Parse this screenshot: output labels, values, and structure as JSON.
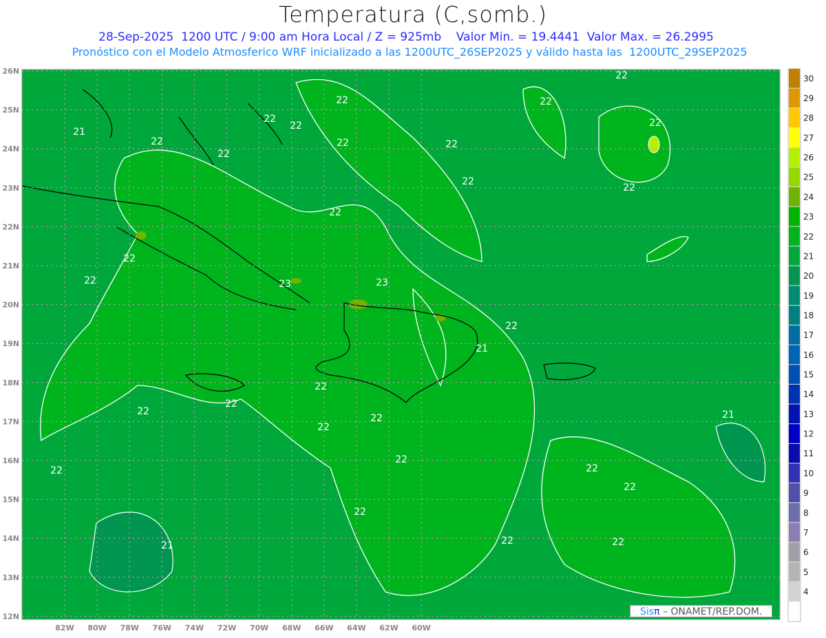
{
  "header": {
    "title": "Temperatura (C,somb.)",
    "line1": "28-Sep-2025  1200 UTC / 9:00 am Hora Local / Z = 925mb    Valor Min. = 19.4441  Valor Max. = 26.2995",
    "line2": "Pronóstico con el Modelo Atmosferico WRF inicializado a las 1200UTC_26SEP2025 y válido hasta las  1200UTC_29SEP2025"
  },
  "map": {
    "lon_labels": [
      "82W",
      "80W",
      "78W",
      "76W",
      "74W",
      "72W",
      "70W",
      "68W",
      "66W",
      "64W",
      "62W",
      "60W"
    ],
    "lat_labels": [
      "26N",
      "25N",
      "24N",
      "23N",
      "22N",
      "21N",
      "20N",
      "19N",
      "18N",
      "17N",
      "16N",
      "15N",
      "14N",
      "13N",
      "12N"
    ],
    "contour_labels": [
      "22",
      "22",
      "22",
      "22",
      "22",
      "22",
      "22",
      "22",
      "22",
      "22",
      "22",
      "22",
      "22",
      "21",
      "21",
      "21",
      "22",
      "22",
      "22",
      "22",
      "22",
      "22",
      "22",
      "23",
      "23",
      "22",
      "22",
      "22",
      "22",
      "22",
      "22",
      "22",
      "21",
      "22"
    ]
  },
  "colorbar": {
    "labels": [
      "30",
      "29",
      "28",
      "27",
      "26",
      "25",
      "24",
      "23",
      "22",
      "21",
      "20",
      "19",
      "18",
      "17",
      "16",
      "15",
      "14",
      "13",
      "12",
      "11",
      "10",
      "9",
      "8",
      "7",
      "6",
      "5",
      "4"
    ],
    "colors": [
      "#c08000",
      "#e09800",
      "#ffc800",
      "#ffff00",
      "#b4f000",
      "#96d800",
      "#6eb400",
      "#00b400",
      "#00b41e",
      "#00a83c",
      "#009650",
      "#008c6e",
      "#008080",
      "#006ea0",
      "#0064b4",
      "#0050b4",
      "#0032b4",
      "#0014b4",
      "#0000c8",
      "#0a0aaf",
      "#3232b4",
      "#5050a8",
      "#6e6eaa",
      "#8c7db4",
      "#a0a0a8",
      "#b4b4b4",
      "#d2d2d2",
      "#ffffff"
    ]
  },
  "logo": {
    "brand": "Sis",
    "pi": "π",
    "text": " –  ONAMET/REP.DOM."
  }
}
